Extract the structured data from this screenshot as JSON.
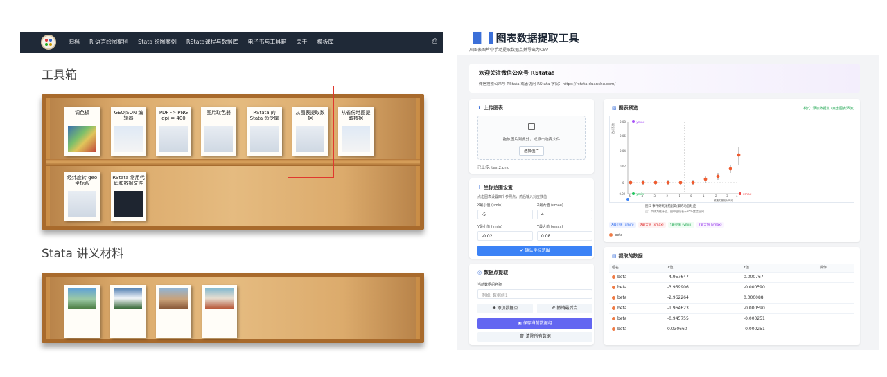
{
  "left": {
    "nav": {
      "items": [
        "归档",
        "R 语言绘图案例",
        "Stata 绘图案例",
        "RStata课程与数据库",
        "电子书与工具箱",
        "关于",
        "模板库"
      ],
      "print_icon": "⎙"
    },
    "toolbox_title": "工具箱",
    "toolbox_books": [
      {
        "title": "调色板"
      },
      {
        "title": "GEOJSON 编辑器"
      },
      {
        "title": "PDF -> PNG dpi = 400"
      },
      {
        "title": "图片取色器"
      },
      {
        "title": "RStata 的 Stata 命令库"
      },
      {
        "title": "从图表提取数据"
      },
      {
        "title": "从省份地图提取数据"
      },
      {
        "title": "经纬度转 geo 坐标系"
      },
      {
        "title": "RStata 常用代码和数据文件"
      }
    ],
    "materials_title": "Stata 讲义材料"
  },
  "right": {
    "title": "图表数据提取工具",
    "subtitle": "从图表图片中手动提取数据点并导出为CSV",
    "welcome_title": "欢迎关注微信公众号 RStata!",
    "welcome_text": "微信搜索公众号 RStata 或者访问 RStata 学院：https://rstata.duanshu.com/",
    "upload": {
      "title": "上传图表",
      "drop_text": "拖放图片到此处，或点击选择文件",
      "button": "选择图片",
      "uploaded": "已上传: test2.png"
    },
    "coords": {
      "title": "坐标范围设置",
      "hint": "点击图表设置四个参照点，然后输入对应数值",
      "xmin_label": "X最小值 (xmin)",
      "xmax_label": "X最大值 (xmax)",
      "ymin_label": "Y最小值 (ymin)",
      "ymax_label": "Y最大值 (ymax)",
      "xmin": "-5",
      "xmax": "4",
      "ymin": "-0.02",
      "ymax": "0.08",
      "confirm": "确认坐标范围"
    },
    "points": {
      "title": "数据点提取",
      "group_label": "当前数据组名称",
      "group_placeholder": "例如: 数据组1",
      "add": "添加数据点",
      "undo": "撤销最后点",
      "save": "保存当前数据组",
      "clear": "清除所有数据"
    },
    "preview": {
      "title": "图表预览",
      "mode": "模式: 添加数据点 (点击图表添加)",
      "legend": [
        "X最小值 (xmin)",
        "X最大值 (xmax)",
        "Y最小值 (ymin)",
        "Y最大值 (ymax)"
      ],
      "series": "beta",
      "markers": {
        "ymax": "ymax",
        "ymin": "ymin",
        "xmin": "xmin",
        "xmax": "xmax"
      },
      "caption": "图 5 事件研究法检验政策的动态效应",
      "caption_note": "注：实线为估计值，图中竖线表示95%置信区间",
      "y_ticks": [
        "0.08",
        "0.06",
        "0.04",
        "0.02",
        "0",
        "-0.02"
      ],
      "x_ticks": [
        "-5",
        "-4",
        "-3",
        "-2",
        "-1",
        "0",
        "1",
        "2",
        "3",
        "4"
      ],
      "x_axis_label": "政策实施相对时间",
      "y_axis_label": "估计系数"
    },
    "table": {
      "title": "提取的数据",
      "headers": [
        "组名",
        "X值",
        "Y值",
        "操作"
      ],
      "rows": [
        {
          "group": "beta",
          "x": "-4.957647",
          "y": "0.000767"
        },
        {
          "group": "beta",
          "x": "-3.959906",
          "y": "-0.000590"
        },
        {
          "group": "beta",
          "x": "-2.962264",
          "y": "0.000088"
        },
        {
          "group": "beta",
          "x": "-1.964623",
          "y": "-0.000590"
        },
        {
          "group": "beta",
          "x": "-0.945755",
          "y": "-0.000251"
        },
        {
          "group": "beta",
          "x": "0.030660",
          "y": "-0.000251"
        }
      ]
    }
  }
}
